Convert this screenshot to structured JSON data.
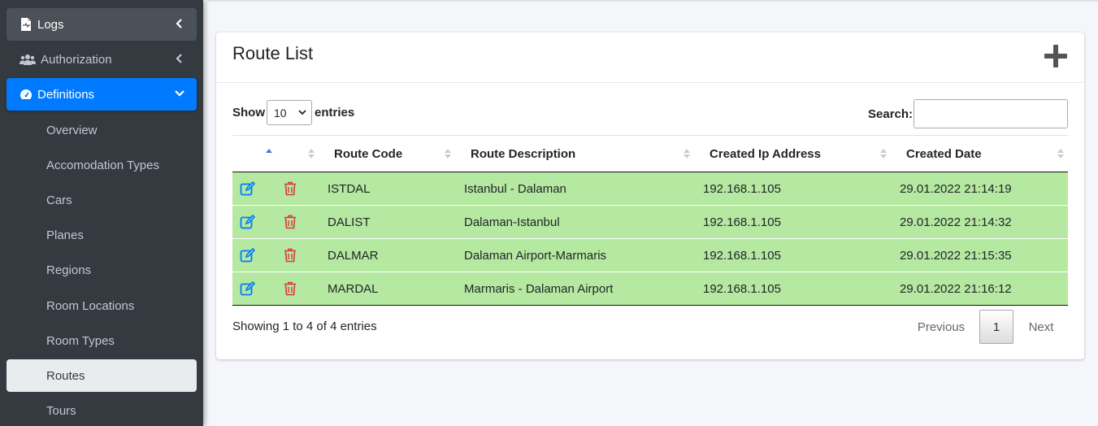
{
  "sidebar": {
    "items": [
      {
        "label": "Logs",
        "icon": "file-icon"
      },
      {
        "label": "Authorization",
        "icon": "users-icon"
      },
      {
        "label": "Definitions",
        "icon": "dashboard-icon"
      }
    ],
    "sub_items": [
      {
        "label": "Overview"
      },
      {
        "label": "Accomodation Types"
      },
      {
        "label": "Cars"
      },
      {
        "label": "Planes"
      },
      {
        "label": "Regions"
      },
      {
        "label": "Room Locations"
      },
      {
        "label": "Room Types"
      },
      {
        "label": "Routes",
        "active": true
      },
      {
        "label": "Tours"
      }
    ]
  },
  "card": {
    "title": "Route List",
    "add_icon": "plus-icon"
  },
  "controls": {
    "show_label": "Show",
    "page_length": "10",
    "entries_label": "entries",
    "search_label": "Search:",
    "search_value": ""
  },
  "table": {
    "columns": [
      "",
      "",
      "Route Code",
      "Route Description",
      "Created Ip Address",
      "Created Date"
    ],
    "rows": [
      {
        "code": "ISTDAL",
        "description": "Istanbul - Dalaman",
        "ip": "192.168.1.105",
        "date": "29.01.2022 21:14:19"
      },
      {
        "code": "DALIST",
        "description": "Dalaman-Istanbul",
        "ip": "192.168.1.105",
        "date": "29.01.2022 21:14:32"
      },
      {
        "code": "DALMAR",
        "description": "Dalaman Airport-Marmaris",
        "ip": "192.168.1.105",
        "date": "29.01.2022 21:15:35"
      },
      {
        "code": "MARDAL",
        "description": "Marmaris - Dalaman Airport",
        "ip": "192.168.1.105",
        "date": "29.01.2022 21:16:12"
      }
    ],
    "row_color": "#b5e8a0"
  },
  "footer": {
    "info": "Showing 1 to 4 of 4 entries",
    "previous": "Previous",
    "page": "1",
    "next": "Next"
  },
  "colors": {
    "sidebar_bg": "#343a40",
    "active_blue": "#007bff",
    "edit_icon": "#007bff",
    "delete_icon": "#dc3545"
  }
}
